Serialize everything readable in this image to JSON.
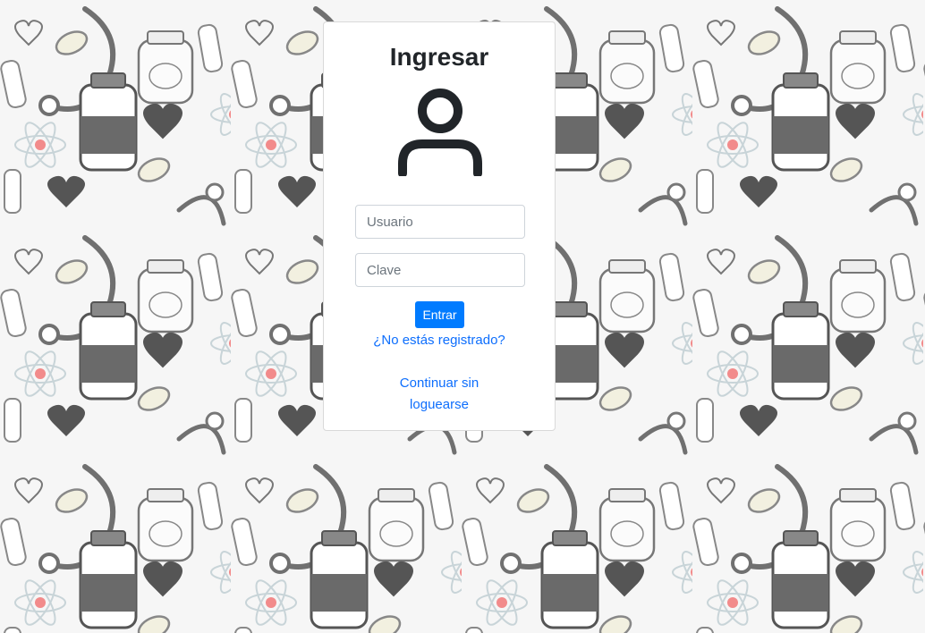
{
  "login": {
    "title": "Ingresar",
    "username_placeholder": "Usuario",
    "password_placeholder": "Clave",
    "submit_label": "Entrar",
    "register_link": "¿No estás registrado?",
    "guest_link": "Continuar sin loguearse"
  },
  "icons": {
    "avatar": "user-icon"
  },
  "colors": {
    "primary": "#007bff",
    "link": "#0d6efd",
    "icon": "#212529",
    "card_background": "#ffffff"
  }
}
